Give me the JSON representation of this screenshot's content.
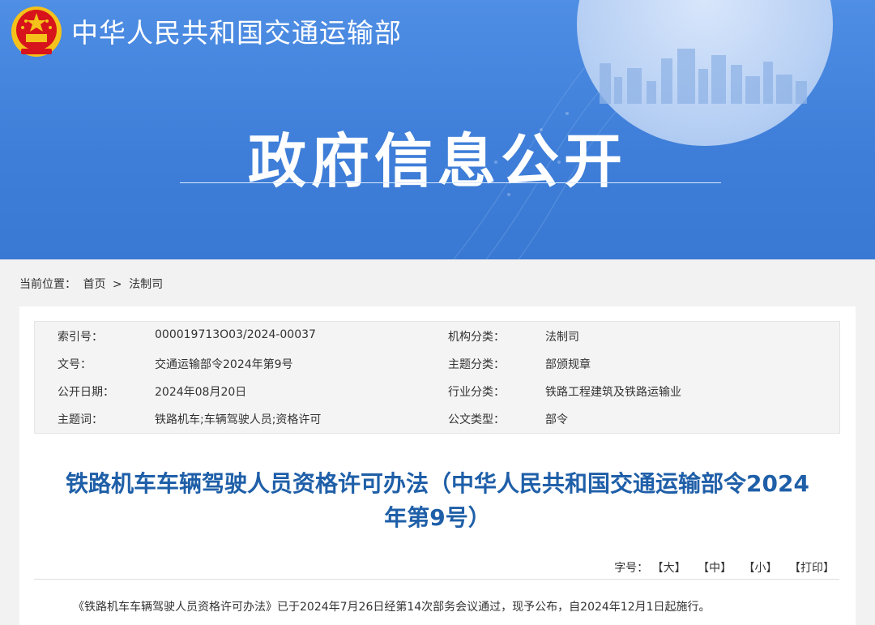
{
  "header": {
    "site_title": "中华人民共和国交通运输部",
    "banner_title": "政府信息公开",
    "emblem_icon": "national-emblem-icon"
  },
  "breadcrumb": {
    "prefix": "当前位置：",
    "home": "首页",
    "separator": ">",
    "current": "法制司"
  },
  "meta": {
    "rows": [
      {
        "l1": "索引号：",
        "v1": "000019713O03/2024-00037",
        "l2": "机构分类：",
        "v2": "法制司"
      },
      {
        "l1": "文号：",
        "v1": "交通运输部令2024年第9号",
        "l2": "主题分类：",
        "v2": "部颁规章"
      },
      {
        "l1": "公开日期：",
        "v1": "2024年08月20日",
        "l2": "行业分类：",
        "v2": "铁路工程建筑及铁路运输业"
      },
      {
        "l1": "主题词：",
        "v1": "铁路机车;车辆驾驶人员;资格许可",
        "l2": "公文类型：",
        "v2": "部令"
      }
    ]
  },
  "document": {
    "title_line1": "铁路机车车辆驾驶人员资格许可办法（中华人民共和国交通运输部令2024",
    "title_line2": "年第9号）",
    "font_label": "字号：",
    "font_large": "【大】",
    "font_medium": "【中】",
    "font_small": "【小】",
    "print": "【打印】",
    "body_first": "《铁路机车车辆驾驶人员资格许可办法》已于2024年7月26日经第14次部务会议通过，现予公布，自2024年12月1日起施行。"
  },
  "colors": {
    "banner_blue": "#3f7fd9",
    "title_blue": "#1f5fa8",
    "emblem_red": "#d7141b",
    "emblem_gold": "#f4c21a"
  }
}
